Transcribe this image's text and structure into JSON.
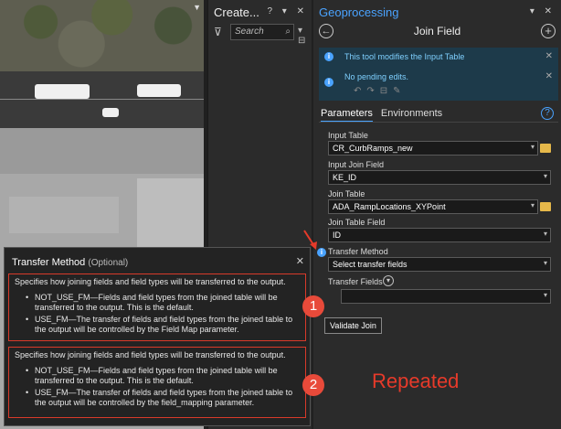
{
  "create_pane": {
    "title": "Create...",
    "controls": "? ▾ ✕",
    "search_placeholder": "Search"
  },
  "geoprocessing": {
    "pane_title": "Geoprocessing",
    "controls": "▾ ✕",
    "tool_name": "Join Field",
    "messages": [
      {
        "text": "This tool modifies the Input Table"
      },
      {
        "text": "No pending edits."
      }
    ],
    "tabs": [
      {
        "label": "Parameters",
        "active": true
      },
      {
        "label": "Environments",
        "active": false
      }
    ],
    "params": {
      "input_table_label": "Input Table",
      "input_table_value": "CR_CurbRamps_new",
      "input_join_field_label": "Input Join Field",
      "input_join_field_value": "KE_ID",
      "join_table_label": "Join Table",
      "join_table_value": "ADA_RampLocations_XYPoint",
      "join_table_field_label": "Join Table Field",
      "join_table_field_value": "ID",
      "transfer_method_label": "Transfer Method",
      "transfer_method_value": "Select transfer fields",
      "transfer_fields_label": "Transfer Fields"
    },
    "validate_label": "Validate Join",
    "annotation": "Repeated"
  },
  "tooltip": {
    "title": "Transfer Method",
    "optional": "(Optional)",
    "blocks": [
      {
        "badge": "1",
        "description": "Specifies how joining fields and field types will be transferred to the output.",
        "items": [
          "NOT_USE_FM—Fields and field types from the joined table will be transferred to the output. This is the default.",
          "USE_FM—The transfer of fields and field types from the joined table to the output will be controlled by the Field Map parameter."
        ]
      },
      {
        "badge": "2",
        "description": "Specifies how joining fields and field types will be transferred to the output.",
        "items": [
          "NOT_USE_FM—Fields and field types from the joined table will be transferred to the output. This is the default.",
          "USE_FM—The transfer of fields and field types from the joined table to the output will be controlled by the field_mapping parameter."
        ]
      }
    ]
  },
  "colors": {
    "accent": "#4aa3ff",
    "annotation_red": "#e63a2a",
    "folder": "#e6b84a"
  }
}
